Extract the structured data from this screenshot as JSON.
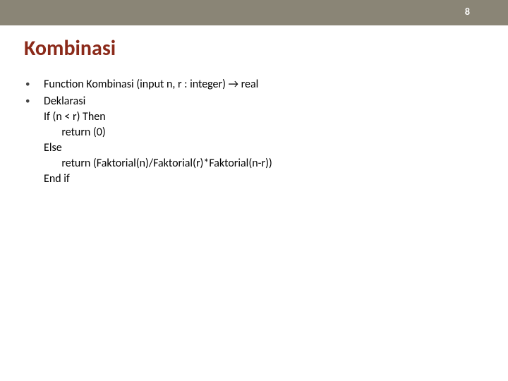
{
  "page_number": "8",
  "title": "Kombinasi",
  "bullets": [
    {
      "lines": [
        "Function Kombinasi (input n, r : integer) → real"
      ]
    },
    {
      "lines": [
        "Deklarasi",
        "If (n < r) Then",
        "       return (0)",
        "Else",
        "       return (Faktorial(n)/Faktorial(r)*Faktorial(n-r))",
        "End if"
      ]
    }
  ]
}
